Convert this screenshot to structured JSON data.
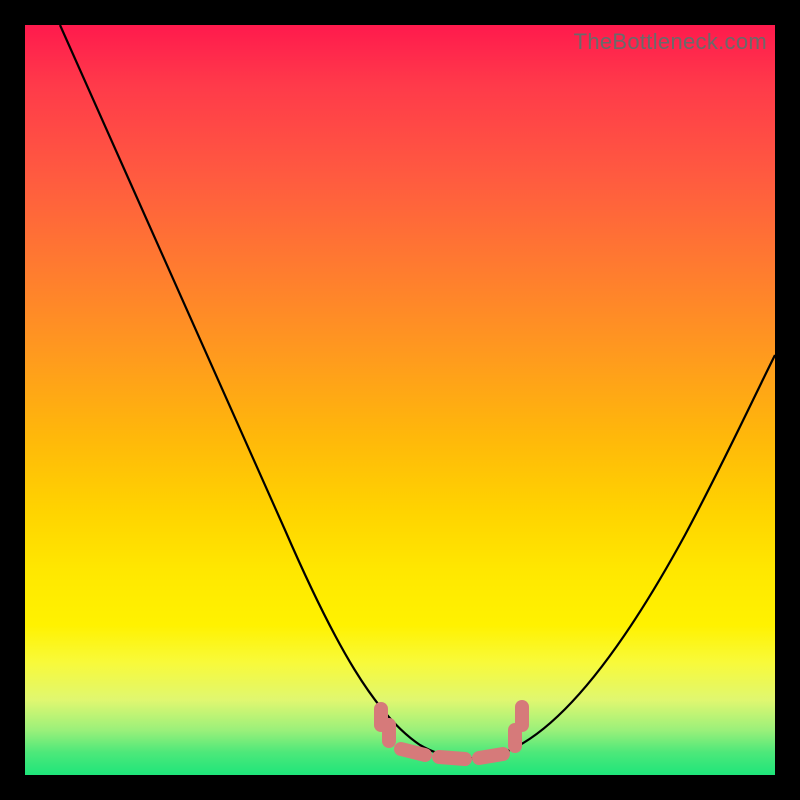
{
  "watermark": "TheBottleneck.com",
  "colors": {
    "background": "#000000",
    "curve": "#000000",
    "band": "#d67a7a"
  },
  "chart_data": {
    "type": "line",
    "title": "",
    "xlabel": "",
    "ylabel": "",
    "xlim": [
      0,
      100
    ],
    "ylim": [
      0,
      100
    ],
    "grid": false,
    "legend": false,
    "series": [
      {
        "name": "bottleneck-curve",
        "x": [
          0,
          10,
          20,
          30,
          40,
          45,
          50,
          55,
          60,
          65,
          70,
          80,
          90,
          100
        ],
        "y": [
          100,
          82,
          62,
          42,
          22,
          12,
          5,
          2,
          2,
          4,
          8,
          20,
          35,
          52
        ]
      }
    ],
    "annotations": [
      {
        "name": "optimal-band",
        "type": "dashed-segment",
        "x_range": [
          46,
          66
        ],
        "y": 3
      }
    ]
  }
}
